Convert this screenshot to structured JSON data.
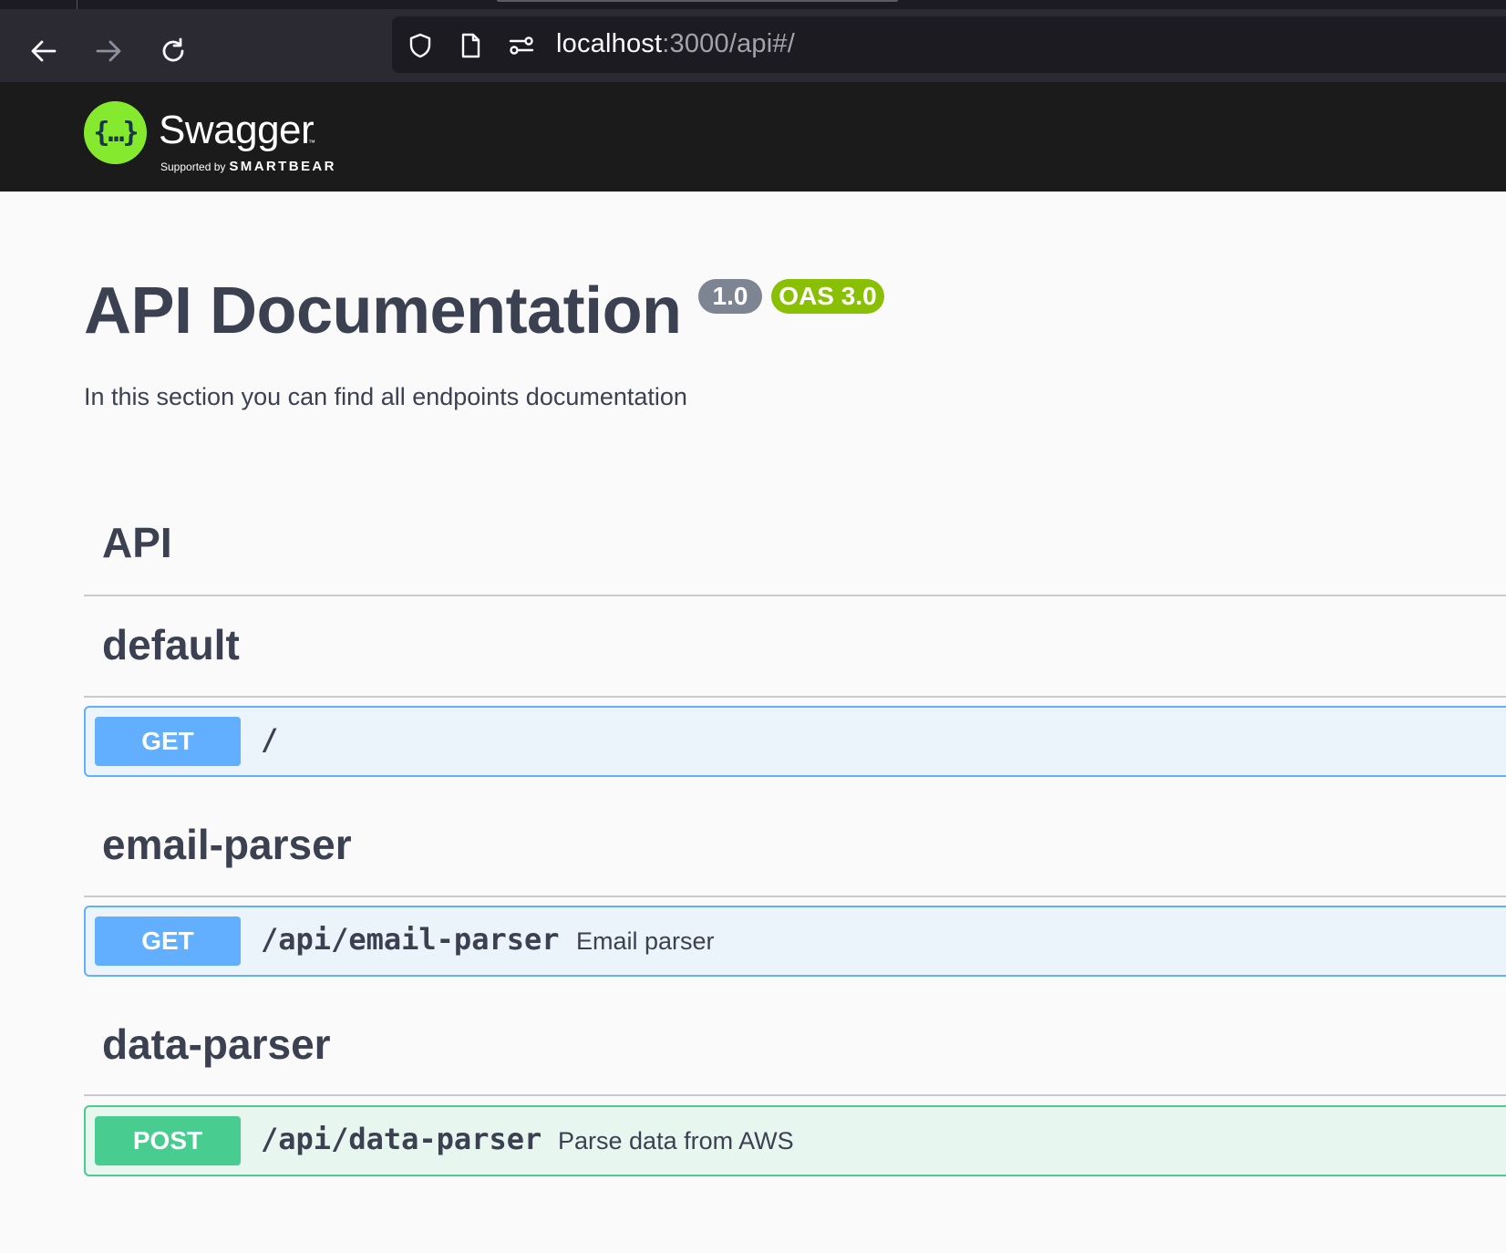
{
  "browser": {
    "url_host": "localhost",
    "url_rest": ":3000/api#/",
    "icons": [
      "back-arrow-icon",
      "forward-arrow-icon",
      "reload-icon",
      "shield-icon",
      "page-icon",
      "permissions-icon"
    ]
  },
  "topbar": {
    "logo_braces": "{…}",
    "logo_word": "Swagger",
    "logo_tm": "™",
    "supported_by": "Supported by",
    "brand": "SMARTBEAR"
  },
  "info": {
    "title": "API Documentation",
    "version": "1.0",
    "oas": "OAS 3.0",
    "description": "In this section you can find all endpoints documentation"
  },
  "api_heading": "API",
  "tags": [
    {
      "name": "default",
      "operations": [
        {
          "method": "GET",
          "path": "/",
          "summary": ""
        }
      ]
    },
    {
      "name": "email-parser",
      "operations": [
        {
          "method": "GET",
          "path": "/api/email-parser",
          "summary": "Email parser"
        }
      ]
    },
    {
      "name": "data-parser",
      "operations": [
        {
          "method": "POST",
          "path": "/api/data-parser",
          "summary": "Parse data from AWS"
        }
      ]
    }
  ],
  "colors": {
    "get": "#61affe",
    "post": "#49cc90",
    "logo_green": "#85ea2d",
    "oas_badge": "#89bf04",
    "version_badge": "#7d8492"
  }
}
